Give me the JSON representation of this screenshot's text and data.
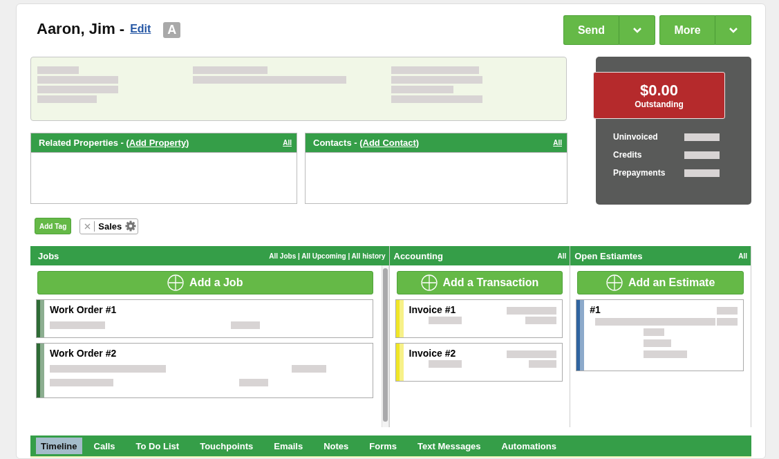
{
  "header": {
    "name": "Aaron, Jim -",
    "edit_link": "Edit",
    "badge": "A",
    "actions": [
      {
        "label": "Send"
      },
      {
        "label": "More"
      }
    ]
  },
  "panels": [
    {
      "title": "Related Properties - (",
      "link": "Add Property",
      "suffix": ")",
      "all": "All"
    },
    {
      "title": "Contacts - (",
      "link": "Add Contact",
      "suffix": ")",
      "all": "All"
    }
  ],
  "balance": {
    "amount": "$0.00",
    "label": "Outstanding",
    "rows": [
      {
        "label": "Uninvoiced"
      },
      {
        "label": "Credits"
      },
      {
        "label": "Prepayments"
      }
    ]
  },
  "tags": {
    "add_button": "Add Tag",
    "items": [
      {
        "label": "Sales"
      }
    ]
  },
  "sections": [
    {
      "title": "Jobs",
      "links": "All Jobs | All Upcoming | All history",
      "add_button": "Add a Job",
      "scrollable": true,
      "cards": [
        {
          "title": "Work Order #1",
          "color": "#2e6b35"
        },
        {
          "title": "Work Order #2",
          "color": "#2e6b35"
        }
      ]
    },
    {
      "title": "Accounting",
      "links": "All",
      "add_button": "Add a Transaction",
      "scrollable": false,
      "cards": [
        {
          "title": "Invoice #1",
          "color": "#f0e626"
        },
        {
          "title": "Invoice #2",
          "color": "#f0e626"
        }
      ]
    },
    {
      "title": "Open Estiamtes",
      "links": "All",
      "add_button": "Add an Estimate",
      "scrollable": false,
      "cards": [
        {
          "title": "#1",
          "color": "#2f64a0"
        }
      ]
    }
  ],
  "tabs": [
    {
      "label": "Timeline",
      "selected": true
    },
    {
      "label": "Calls",
      "selected": false
    },
    {
      "label": "To Do List",
      "selected": false
    },
    {
      "label": "Touchpoints",
      "selected": false
    },
    {
      "label": "Emails",
      "selected": false
    },
    {
      "label": "Notes",
      "selected": false
    },
    {
      "label": "Forms",
      "selected": false
    },
    {
      "label": "Text Messages",
      "selected": false
    },
    {
      "label": "Automations",
      "selected": false
    }
  ]
}
